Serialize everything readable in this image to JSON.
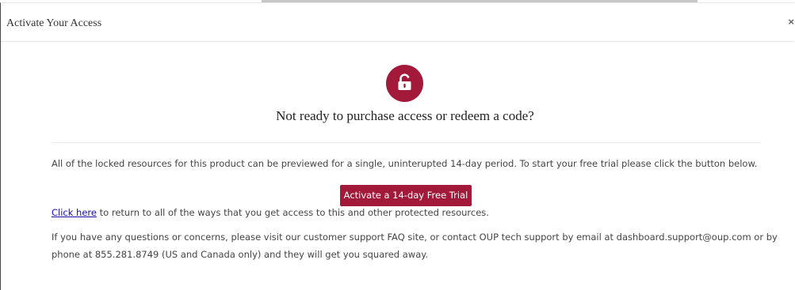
{
  "modal": {
    "title": "Activate Your Access",
    "close_label": "×"
  },
  "icon": {
    "name": "unlock-icon",
    "color": "#a3193a"
  },
  "headline": "Not ready to purchase access or redeem a code?",
  "description": "All of the locked resources for this product can be previewed for a single, uninterupted 14-day period. To start your free trial please click the button below.",
  "trial_button_label": "Activate a 14-day Free Trial",
  "return_link": {
    "link_text": "Click here",
    "rest": " to return to all of the ways that you get access to this and other protected resources."
  },
  "support": {
    "line1": "If you have any questions or concerns, please visit our customer support FAQ site, or contact OUP tech support by email at dashboard.support@oup.com or by",
    "line2": "phone at 855.281.8749 (US and Canada only) and they will get you squared away."
  },
  "colors": {
    "accent": "#a3193a",
    "link": "#1a0dab"
  }
}
